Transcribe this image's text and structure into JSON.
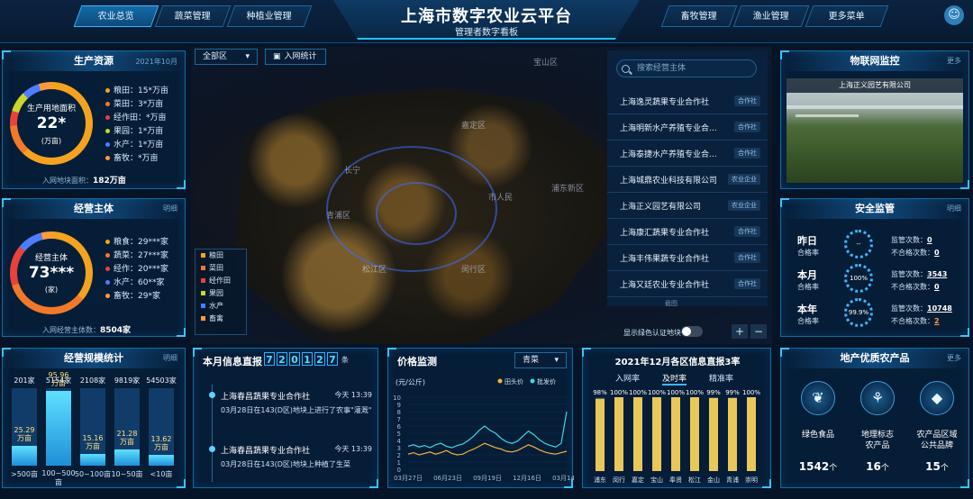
{
  "header": {
    "title": "上海市数字农业云平台",
    "subtitle": "管理者数字看板",
    "nav_left": [
      "农业总览",
      "蔬菜管理",
      "种植业管理"
    ],
    "nav_right": [
      "畜牧管理",
      "渔业管理",
      "更多菜单"
    ],
    "active_tab": "农业总览"
  },
  "production": {
    "title": "生产资源",
    "date": "2021年10月",
    "center_label": "生产用地面积",
    "center_value": "22*",
    "center_unit": "(万亩)",
    "legend": [
      {
        "label": "粮田：15*万亩",
        "color": "#f4a320"
      },
      {
        "label": "菜田：3*万亩",
        "color": "#f07a2a"
      },
      {
        "label": "经作田：*万亩",
        "color": "#e8423a"
      },
      {
        "label": "果园：1*万亩",
        "color": "#c9d62d"
      },
      {
        "label": "水产：1*万亩",
        "color": "#4f7dff"
      },
      {
        "label": "畜牧：*万亩",
        "color": "#ff9a3c"
      }
    ],
    "footer_label": "入网地块面积：",
    "footer_value": "182万亩"
  },
  "entities": {
    "title": "经营主体",
    "link": "明细",
    "center_label": "经营主体",
    "center_value": "73***",
    "center_unit": "(家)",
    "legend": [
      {
        "label": "粮食：29***家",
        "color": "#f4a320"
      },
      {
        "label": "蔬菜：27***家",
        "color": "#f07a2a"
      },
      {
        "label": "经作：20***家",
        "color": "#e8423a"
      },
      {
        "label": "水产：60**家",
        "color": "#4f7dff"
      },
      {
        "label": "畜牧：29*家",
        "color": "#ff9a3c"
      }
    ],
    "footer_label": "入网经营主体数：",
    "footer_value": "8504家"
  },
  "scale": {
    "title": "经营规模统计",
    "link": "明细",
    "chart_data": {
      "type": "bar",
      "categories": [
        ">500亩",
        "100~500亩",
        "50~100亩",
        "10~50亩",
        "<10亩"
      ],
      "counts": [
        "201家",
        "5154家",
        "2108家",
        "9819家",
        "54503家"
      ],
      "values": [
        25.29,
        95.96,
        15.16,
        21.28,
        13.62
      ],
      "value_labels": [
        "25.29\n万亩",
        "95.96\n万亩",
        "15.16\n万亩",
        "21.28\n万亩",
        "13.62\n万亩"
      ]
    }
  },
  "map": {
    "region_select": "全部区",
    "net_stats": "入网统计",
    "labels": [
      "宝山区",
      "浦东新区",
      "青浦区",
      "闵行区",
      "松江区",
      "嘉定区",
      "长宁",
      "市人民"
    ],
    "legend": [
      {
        "label": "粮田",
        "color": "#f4a320"
      },
      {
        "label": "菜田",
        "color": "#f07a2a"
      },
      {
        "label": "经作田",
        "color": "#e8423a"
      },
      {
        "label": "果园",
        "color": "#c9d62d"
      },
      {
        "label": "水产",
        "color": "#4f7dff"
      },
      {
        "label": "畜禽",
        "color": "#ff9a3c"
      }
    ],
    "green_toggle_label": "显示绿色认证地块",
    "more_label": "截图"
  },
  "entity_list": {
    "search_placeholder": "搜索经营主体",
    "items": [
      {
        "name": "上海逸灵蔬果专业合作社",
        "tag": "合作社"
      },
      {
        "name": "上海明新水产养殖专业合...",
        "tag": "合作社"
      },
      {
        "name": "上海泰捷水产养殖专业合...",
        "tag": "合作社"
      },
      {
        "name": "上海城鼎农业科技有限公司",
        "tag": "农业企业"
      },
      {
        "name": "上海正义园艺有限公司",
        "tag": "农业企业"
      },
      {
        "name": "上海康汇蔬果专业合作社",
        "tag": "合作社"
      },
      {
        "name": "上海丰伟果蔬专业合作社",
        "tag": "合作社"
      },
      {
        "name": "上海又廷农业专业合作社",
        "tag": "合作社"
      }
    ]
  },
  "iot": {
    "title": "物联网监控",
    "link": "更多",
    "camera_title": "上海正义园艺有限公司"
  },
  "safety": {
    "title": "安全监管",
    "link": "明细",
    "rows": [
      {
        "period": "昨日",
        "rate_label": "合格率",
        "ring": "--",
        "checks_label": "监管次数：",
        "checks": "0",
        "fail_label": "不合格次数：",
        "fail": "0"
      },
      {
        "period": "本月",
        "rate_label": "合格率",
        "ring": "100%",
        "checks_label": "监管次数：",
        "checks": "3543",
        "fail_label": "不合格次数：",
        "fail": "0"
      },
      {
        "period": "本年",
        "rate_label": "合格率",
        "ring": "99.9%",
        "checks_label": "监管次数：",
        "checks": "10748",
        "fail_label": "不合格次数：",
        "fail": "2"
      }
    ]
  },
  "info_feed": {
    "title": "本月信息直报",
    "digits": [
      "7",
      "2",
      "0",
      "1",
      "2",
      "7"
    ],
    "unit": "条",
    "items": [
      {
        "org": "上海春昌蔬果专业合作社",
        "time": "今天 13:39",
        "text": "03月28日在143(D区)地块上进行了农事\"灌溉\""
      },
      {
        "org": "上海春昌蔬果专业合作社",
        "time": "今天 13:39",
        "text": "03月28日在143(D区)地块上种植了生菜"
      }
    ]
  },
  "price": {
    "title": "价格监测",
    "select": "青菜",
    "unit_label": "(元/公斤)",
    "chart_data": {
      "type": "line",
      "x": [
        "03月27日",
        "06月23日",
        "09月19日",
        "12月16日",
        "03月14日"
      ],
      "ylim": [
        0,
        10
      ],
      "yticks": [
        0,
        1,
        2,
        3,
        4,
        5,
        6,
        7,
        8,
        9,
        10
      ],
      "series": [
        {
          "name": "田头价",
          "color": "#f4b23a",
          "values": [
            2.1,
            2.3,
            2.0,
            2.2,
            2.4,
            2.1,
            2.3,
            2.6,
            2.2,
            2.0,
            2.1,
            2.5,
            2.8,
            3.2,
            3.6,
            3.3,
            3.0,
            2.8,
            2.5,
            2.4,
            2.6,
            3.0,
            3.4,
            3.1,
            2.7,
            2.4,
            2.2,
            2.1,
            2.3,
            2.5
          ]
        },
        {
          "name": "批发价",
          "color": "#3fd6e8",
          "values": [
            3.2,
            3.4,
            3.1,
            3.3,
            3.0,
            3.4,
            3.6,
            3.2,
            3.0,
            3.3,
            3.5,
            4.0,
            4.6,
            5.4,
            6.0,
            5.4,
            5.0,
            4.3,
            3.8,
            3.6,
            3.9,
            4.6,
            5.3,
            4.8,
            4.1,
            3.6,
            3.3,
            3.1,
            3.6,
            8.0
          ]
        }
      ]
    }
  },
  "district_rate": {
    "title": "2021年12月各区信息直报3率",
    "tabs": [
      "入网率",
      "及时率",
      "精准率"
    ],
    "active_tab": "及时率",
    "chart_data": {
      "type": "bar",
      "categories": [
        "浦东",
        "闵行",
        "嘉定",
        "宝山",
        "奉贤",
        "松江",
        "金山",
        "青浦",
        "崇明"
      ],
      "values": [
        98,
        100,
        100,
        100,
        100,
        100,
        99,
        99,
        100
      ],
      "value_labels": [
        "98%",
        "100%",
        "100%",
        "100%",
        "100%",
        "100%",
        "99%",
        "99%",
        "100%"
      ],
      "ylim": [
        0,
        100
      ]
    }
  },
  "quality": {
    "title": "地产优质农产品",
    "link": "更多",
    "items": [
      {
        "label": "绿色食品",
        "value": "1542",
        "unit": "个",
        "icon": "leaf-shield-icon"
      },
      {
        "label": "地理标志\n农产品",
        "value": "16",
        "unit": "个",
        "icon": "geo-mark-icon"
      },
      {
        "label": "农产品区域\n公共品牌",
        "value": "15",
        "unit": "个",
        "icon": "diamond-icon"
      }
    ]
  }
}
